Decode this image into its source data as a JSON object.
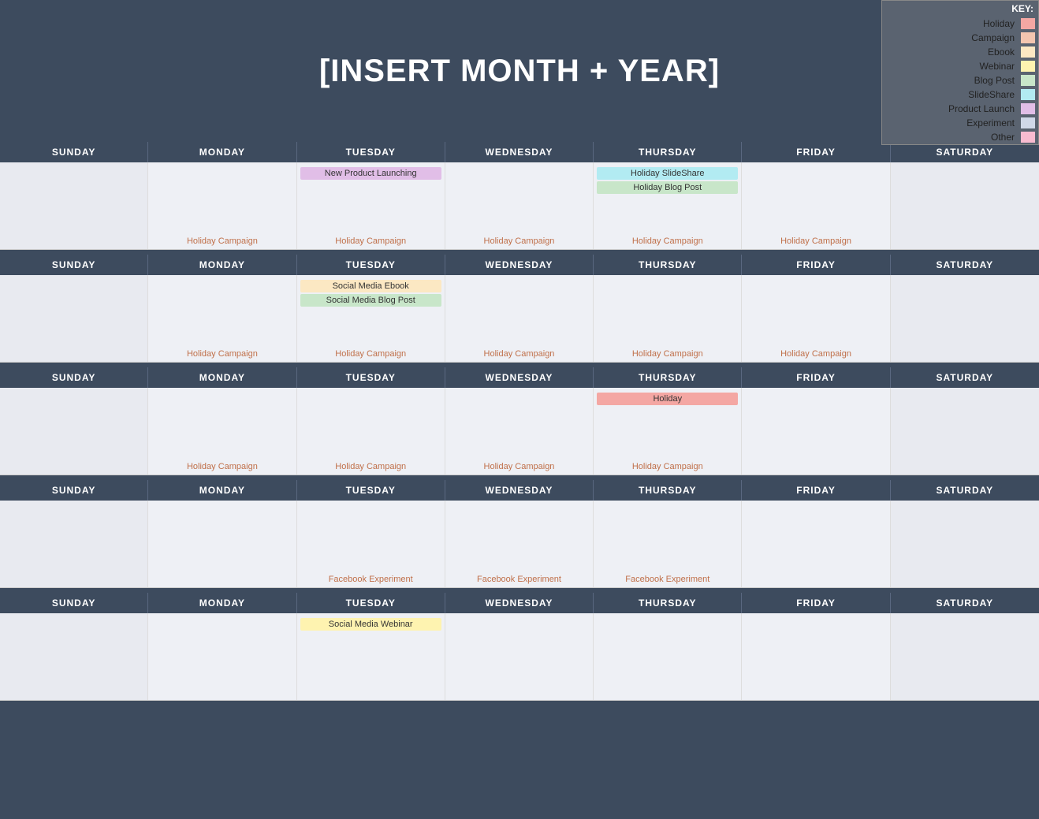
{
  "header": {
    "title": "[INSERT MONTH + YEAR]"
  },
  "key": {
    "title": "KEY:",
    "items": [
      {
        "label": "Holiday",
        "color": "#f4a7a3"
      },
      {
        "label": "Campaign",
        "color": "#f4c6b0"
      },
      {
        "label": "Ebook",
        "color": "#fce8c3"
      },
      {
        "label": "Webinar",
        "color": "#fef3b0"
      },
      {
        "label": "Blog Post",
        "color": "#c8e6c9"
      },
      {
        "label": "SlideShare",
        "color": "#b2ebf2"
      },
      {
        "label": "Product Launch",
        "color": "#e1bee7"
      },
      {
        "label": "Experiment",
        "color": "#d0d8e8"
      },
      {
        "label": "Other",
        "color": "#f8bbd0"
      }
    ]
  },
  "days": [
    "SUNDAY",
    "MONDAY",
    "TUESDAY",
    "WEDNESDAY",
    "THURSDAY",
    "FRIDAY",
    "SATURDAY"
  ],
  "weeks": [
    {
      "cells": [
        {
          "events": [],
          "footer": ""
        },
        {
          "events": [],
          "footer": "Holiday Campaign"
        },
        {
          "events": [
            {
              "label": "New Product Launching",
              "class": "tag-product"
            }
          ],
          "footer": "Holiday Campaign"
        },
        {
          "events": [],
          "footer": "Holiday Campaign"
        },
        {
          "events": [
            {
              "label": "Holiday SlideShare",
              "class": "tag-slideshare"
            },
            {
              "label": "Holiday Blog Post",
              "class": "tag-blogpost"
            }
          ],
          "footer": "Holiday Campaign"
        },
        {
          "events": [],
          "footer": "Holiday Campaign"
        },
        {
          "events": [],
          "footer": ""
        }
      ]
    },
    {
      "cells": [
        {
          "events": [],
          "footer": ""
        },
        {
          "events": [],
          "footer": "Holiday Campaign"
        },
        {
          "events": [
            {
              "label": "Social Media Ebook",
              "class": "tag-ebook"
            },
            {
              "label": "Social Media Blog Post",
              "class": "tag-blogpost"
            }
          ],
          "footer": "Holiday Campaign"
        },
        {
          "events": [],
          "footer": "Holiday Campaign"
        },
        {
          "events": [],
          "footer": "Holiday Campaign"
        },
        {
          "events": [],
          "footer": "Holiday Campaign"
        },
        {
          "events": [],
          "footer": ""
        }
      ]
    },
    {
      "cells": [
        {
          "events": [],
          "footer": ""
        },
        {
          "events": [],
          "footer": "Holiday Campaign"
        },
        {
          "events": [],
          "footer": "Holiday Campaign"
        },
        {
          "events": [],
          "footer": "Holiday Campaign"
        },
        {
          "events": [
            {
              "label": "Holiday",
              "class": "tag-holiday"
            }
          ],
          "footer": "Holiday Campaign"
        },
        {
          "events": [],
          "footer": ""
        },
        {
          "events": [],
          "footer": ""
        }
      ]
    },
    {
      "cells": [
        {
          "events": [],
          "footer": ""
        },
        {
          "events": [],
          "footer": ""
        },
        {
          "events": [],
          "footer": "Facebook Experiment"
        },
        {
          "events": [],
          "footer": "Facebook Experiment"
        },
        {
          "events": [],
          "footer": "Facebook Experiment"
        },
        {
          "events": [],
          "footer": ""
        },
        {
          "events": [],
          "footer": ""
        }
      ]
    },
    {
      "cells": [
        {
          "events": [],
          "footer": ""
        },
        {
          "events": [],
          "footer": ""
        },
        {
          "events": [
            {
              "label": "Social Media Webinar",
              "class": "tag-webinar"
            }
          ],
          "footer": ""
        },
        {
          "events": [],
          "footer": ""
        },
        {
          "events": [],
          "footer": ""
        },
        {
          "events": [],
          "footer": ""
        },
        {
          "events": [],
          "footer": ""
        }
      ]
    }
  ]
}
